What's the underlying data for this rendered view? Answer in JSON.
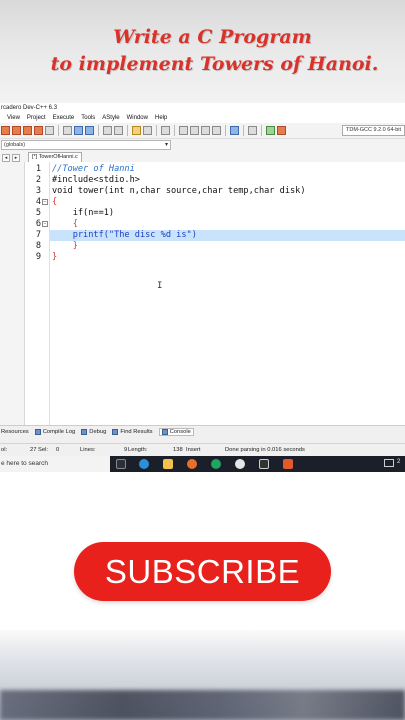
{
  "headline": {
    "line1": "Write a C Program",
    "line2": "to implement Towers of Hanoi."
  },
  "ide": {
    "title": "rcadero Dev-C++ 6.3",
    "menu": [
      "View",
      "Project",
      "Execute",
      "Tools",
      "AStyle",
      "Window",
      "Help"
    ],
    "compiler": "TDM-GCC 9.2.0 64-bit",
    "scope": "(globals)",
    "file_tab": "[*] TowerOfHanni.c",
    "nav_prev": "◂",
    "nav_next": "▸",
    "code": [
      {
        "num": "1",
        "text": "//Tower of Hanni"
      },
      {
        "num": "2",
        "text": "#include<stdio.h>"
      },
      {
        "num": "3",
        "text": "void tower(int n,char source,char temp,char disk)"
      },
      {
        "num": "4",
        "text": "{"
      },
      {
        "num": "5",
        "text": "    if(n==1)"
      },
      {
        "num": "6",
        "text": "    {"
      },
      {
        "num": "7",
        "text": "    printf(\"The disc %d is\")"
      },
      {
        "num": "8",
        "text": "    }"
      },
      {
        "num": "9",
        "text": "}"
      }
    ],
    "bottom_tabs": [
      "Resources",
      "Compile Log",
      "Debug",
      "Find Results",
      "Console"
    ],
    "status": {
      "col": "ol:",
      "sel": "27 Sel:",
      "sel_val": "0",
      "lines": "Lines:",
      "lines_val": "9",
      "length": "Length:",
      "length_val": "138",
      "mode": "Insert",
      "message": "Done parsing in 0.016 seconds"
    }
  },
  "taskbar": {
    "search_placeholder": "e here to search",
    "tray_text": "2"
  },
  "subscribe_label": "SUBSCRIBE",
  "colors": {
    "headline": "#d8332b",
    "subscribe_bg": "#e8211c",
    "highlight_line": "#c8e3fb",
    "comment": "#2a6fc9",
    "brace": "#dd3333"
  }
}
